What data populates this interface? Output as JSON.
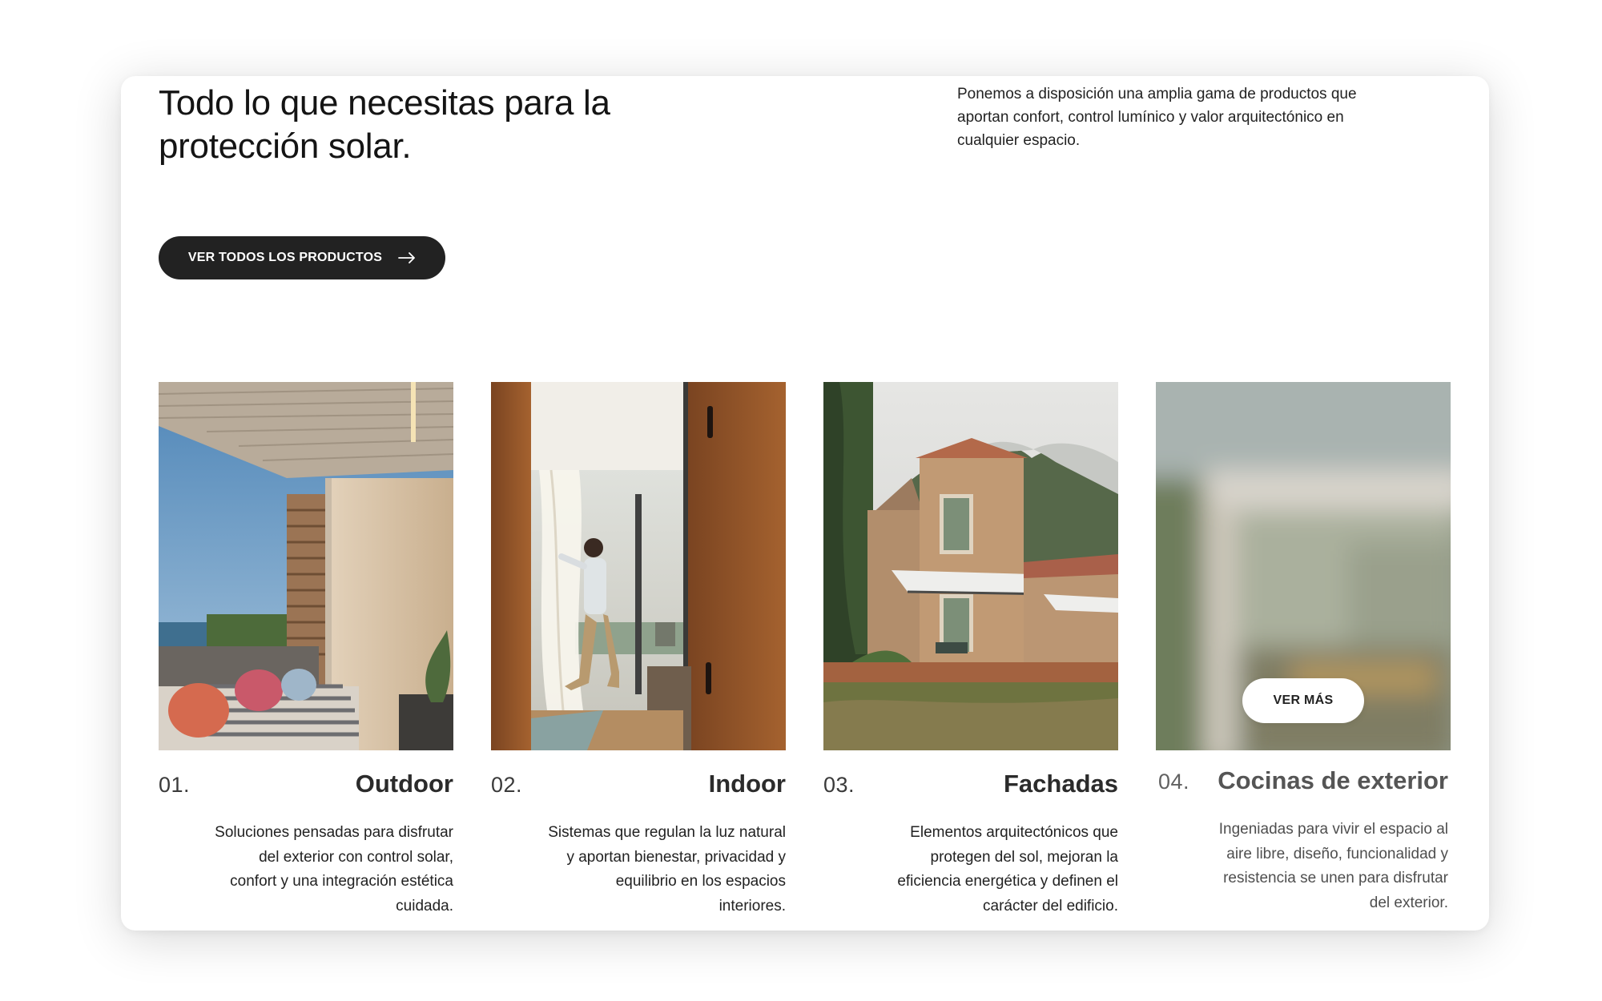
{
  "hero": {
    "title": "Todo lo que necesitas para la protección solar.",
    "intro": "Ponemos a disposición una amplia gama de productos que aportan confort, control lumínico y valor arquitectónico en cualquier espacio.",
    "cta_label": "VER TODOS LOS PRODUCTOS",
    "cta_icon": "arrow-right-icon"
  },
  "products": [
    {
      "number": "01.",
      "name": "Outdoor",
      "description": "Soluciones pensadas para disfrutar del exterior con control solar, confort y una integración estética cuidada.",
      "image": "terrace-pergola-photo"
    },
    {
      "number": "02.",
      "name": "Indoor",
      "description": "Sistemas que regulan la luz natural y aportan bienestar, privacidad y equilibrio en los espacios interiores.",
      "image": "man-opening-curtain-photo"
    },
    {
      "number": "03.",
      "name": "Fachadas",
      "description": "Elementos arquitectónicos que protegen del sol, mejoran la eficiencia energética y definen el carácter del edificio.",
      "image": "stone-house-awning-photo"
    },
    {
      "number": "04.",
      "name": "Cocinas de exterior",
      "description": "Ingeniadas para vivir el espacio al aire libre, diseño, funcionalidad y resistencia se unen para disfrutar del exterior.",
      "image": "blurred-outdoor-kitchen-photo",
      "hover_button": "VER MÁS"
    }
  ],
  "colors": {
    "button_dark": "#222222",
    "text": "#1b1b1b",
    "background": "#ffffff"
  }
}
